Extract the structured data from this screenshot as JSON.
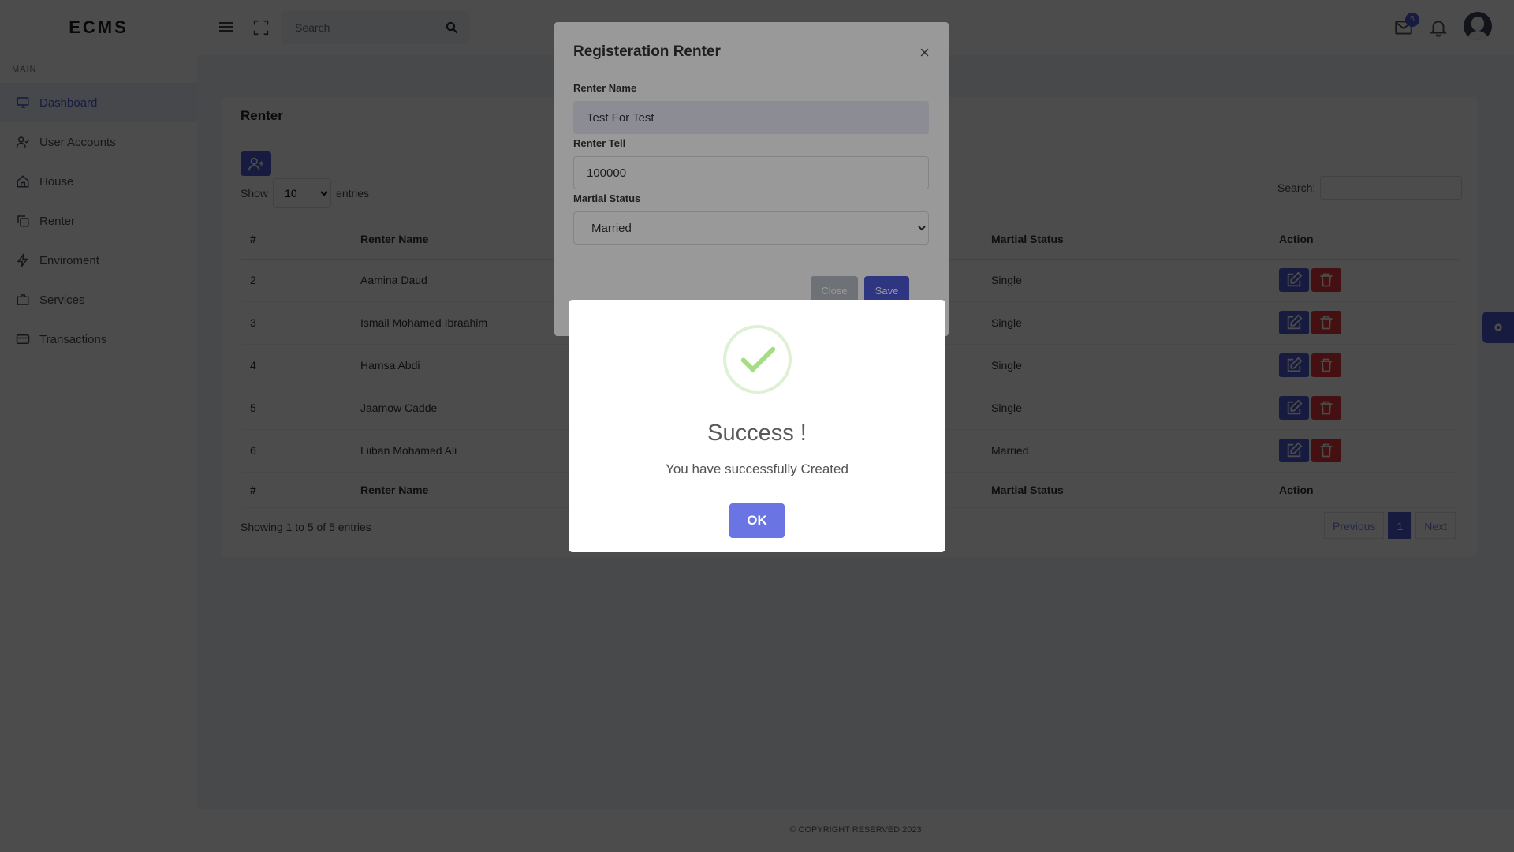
{
  "header": {
    "brand": "ECMS",
    "search_placeholder": "Search",
    "mail_badge": "6"
  },
  "sidebar": {
    "section_label": "MAIN",
    "items": [
      {
        "label": "Dashboard",
        "icon": "monitor-icon"
      },
      {
        "label": "User Accounts",
        "icon": "user-check-icon"
      },
      {
        "label": "House",
        "icon": "home-icon"
      },
      {
        "label": "Renter",
        "icon": "copy-icon"
      },
      {
        "label": "Enviroment",
        "icon": "zap-icon"
      },
      {
        "label": "Services",
        "icon": "briefcase-icon"
      },
      {
        "label": "Transactions",
        "icon": "credit-card-icon"
      }
    ]
  },
  "page": {
    "title": "Renter",
    "show_label": "Show",
    "entries_value": "10",
    "entries_label": "entries",
    "search_label": "Search:",
    "columns": {
      "num": "#",
      "name": "Renter Name",
      "status": "Martial Status",
      "action": "Action"
    },
    "rows": [
      {
        "num": "2",
        "name": "Aamina Daud",
        "status": "Single"
      },
      {
        "num": "3",
        "name": "Ismail Mohamed Ibraahim",
        "status": "Single"
      },
      {
        "num": "4",
        "name": "Hamsa Abdi",
        "status": "Single"
      },
      {
        "num": "5",
        "name": "Jaamow Cadde",
        "status": "Single"
      },
      {
        "num": "6",
        "name": "Liiban Mohamed Ali",
        "status": "Married"
      }
    ],
    "showing_text": "Showing 1 to 5 of 5 entries",
    "pager": {
      "prev": "Previous",
      "current": "1",
      "next": "Next"
    }
  },
  "footer": {
    "text": "© COPYRIGHT RESERVED 2023"
  },
  "modal": {
    "title": "Registeration Renter",
    "close_x": "×",
    "name_label": "Renter Name",
    "name_value": "Test For Test",
    "tell_label": "Renter Tell",
    "tell_value": "100000",
    "status_label": "Martial Status",
    "status_value": "Married",
    "close_button": "Close",
    "save_button": "Save"
  },
  "alert": {
    "title": "Success !",
    "text": "You have successfully Created",
    "ok": "OK"
  },
  "colors": {
    "accent": "#4e5bd8",
    "danger": "#e4363b",
    "success": "#a5dc86"
  }
}
